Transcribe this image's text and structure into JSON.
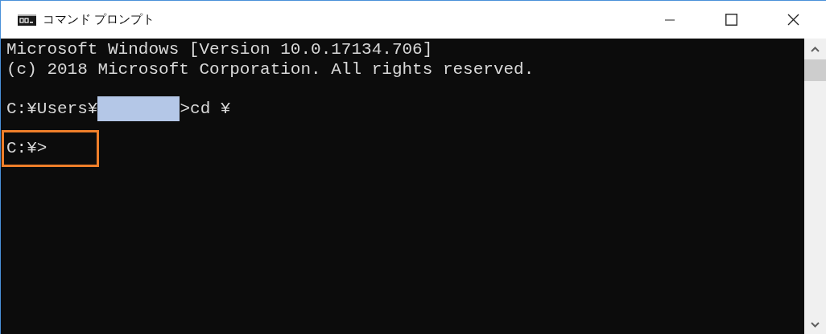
{
  "window": {
    "title": "コマンド プロンプト"
  },
  "console": {
    "lines": [
      {
        "kind": "text",
        "text": "Microsoft Windows [Version 10.0.17134.706]"
      },
      {
        "kind": "text",
        "text": "(c) 2018 Microsoft Corporation. All rights reserved."
      },
      {
        "kind": "blank"
      },
      {
        "kind": "redacted",
        "before": "C:¥Users¥",
        "after": ">cd ¥"
      },
      {
        "kind": "blank"
      },
      {
        "kind": "highlighted",
        "text": "C:¥>"
      }
    ]
  }
}
